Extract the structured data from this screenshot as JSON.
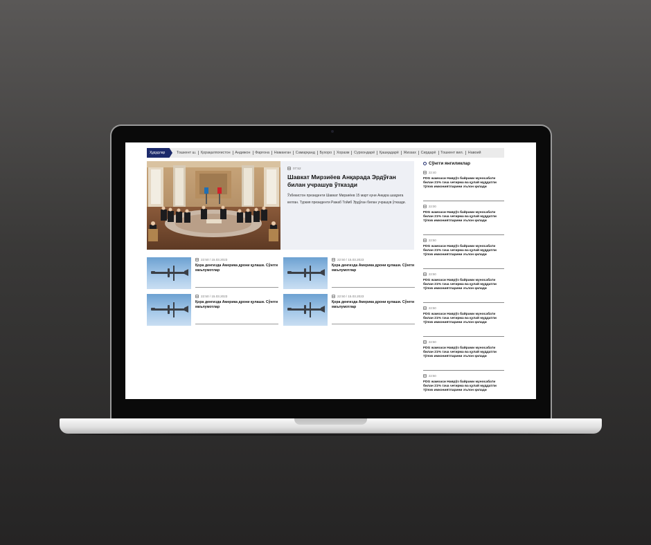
{
  "nav": {
    "region_label": "Ҳудудлар",
    "regions": [
      "Тошкент ш.",
      "Қорақалпоғистон",
      "Андижон",
      "Фарғона",
      "Наманган",
      "Самарқанд",
      "Бухоро",
      "Хоразм",
      "Сурхондарё",
      "Қашқадарё",
      "Жиззах",
      "Сирдарё",
      "Тошкент вил.",
      "Навоий"
    ]
  },
  "featured": {
    "time": "07:52",
    "title": "Шавкат Мирзиёев Анқарада Эрдўған билан учрашув ўтказди",
    "excerpt": "Ўзбекистон президенти Шавкат Мирзиёев 15 март куни Анқара шаҳрига келган. Туркия президенти Ражаб Тойиб Эрдўған билан учрашув ўтказди."
  },
  "cards": [
    {
      "date": "22:50 / 15.03.2023",
      "title": "Қора денгизда Америка дрони қулаши. Сўнгги маълумотлар"
    },
    {
      "date": "22:50 / 15.03.2023",
      "title": "Қора денгизда Америка дрони қулаши. Сўнгги маълумотлар"
    },
    {
      "date": "22:50 / 15.03.2023",
      "title": "Қора денгизда Америка дрони қулаши. Сўнгги маълумотлар"
    },
    {
      "date": "22:50 / 15.03.2023",
      "title": "Қора денгизда Америка дрони қулаши. Сўнгги маълумотлар"
    }
  ],
  "sidebar": {
    "title": "Сўнгги янгиликлар",
    "items": [
      {
        "time": "22:40",
        "text": "FDG жамоаси Наврўз байрами муносабати билан 21% гача чегирма ва қулай муддатли тўлов имкониятларини эълон қилади"
      },
      {
        "time": "22:00",
        "text": "FDG жамоаси Наврўз байрами муносабати билан 21% гача чегирма ва қулай муддатли тўлов имкониятларини эълон қилади"
      },
      {
        "time": "22:50",
        "text": "FDG жамоаси Наврўз байрами муносабати билан 21% гача чегирма ва қулай муддатли тўлов имкониятларини эълон қилади"
      },
      {
        "time": "22:50",
        "text": "FDG жамоаси Наврўз байрами муносабати билан 21% гача чегирма ва қулай муддатли тўлов имкониятларини эълон қилади"
      },
      {
        "time": "22:50",
        "text": "FDG жамоаси Наврўз байрами муносабати билан 21% гача чегирма ва қулай муддатли тўлов имкониятларини эълон қилади"
      },
      {
        "time": "22:50",
        "text": "FDG жамоаси Наврўз байрами муносабати билан 21% гача чегирма ва қулай муддатли тўлов имкониятларини эълон қилади"
      },
      {
        "time": "22:50",
        "text": "FDG жамоаси Наврўз байрами муносабати билан 21% гача чегирма ва қулай муддатли тўлов имкониятларини эълон қилади"
      }
    ]
  }
}
